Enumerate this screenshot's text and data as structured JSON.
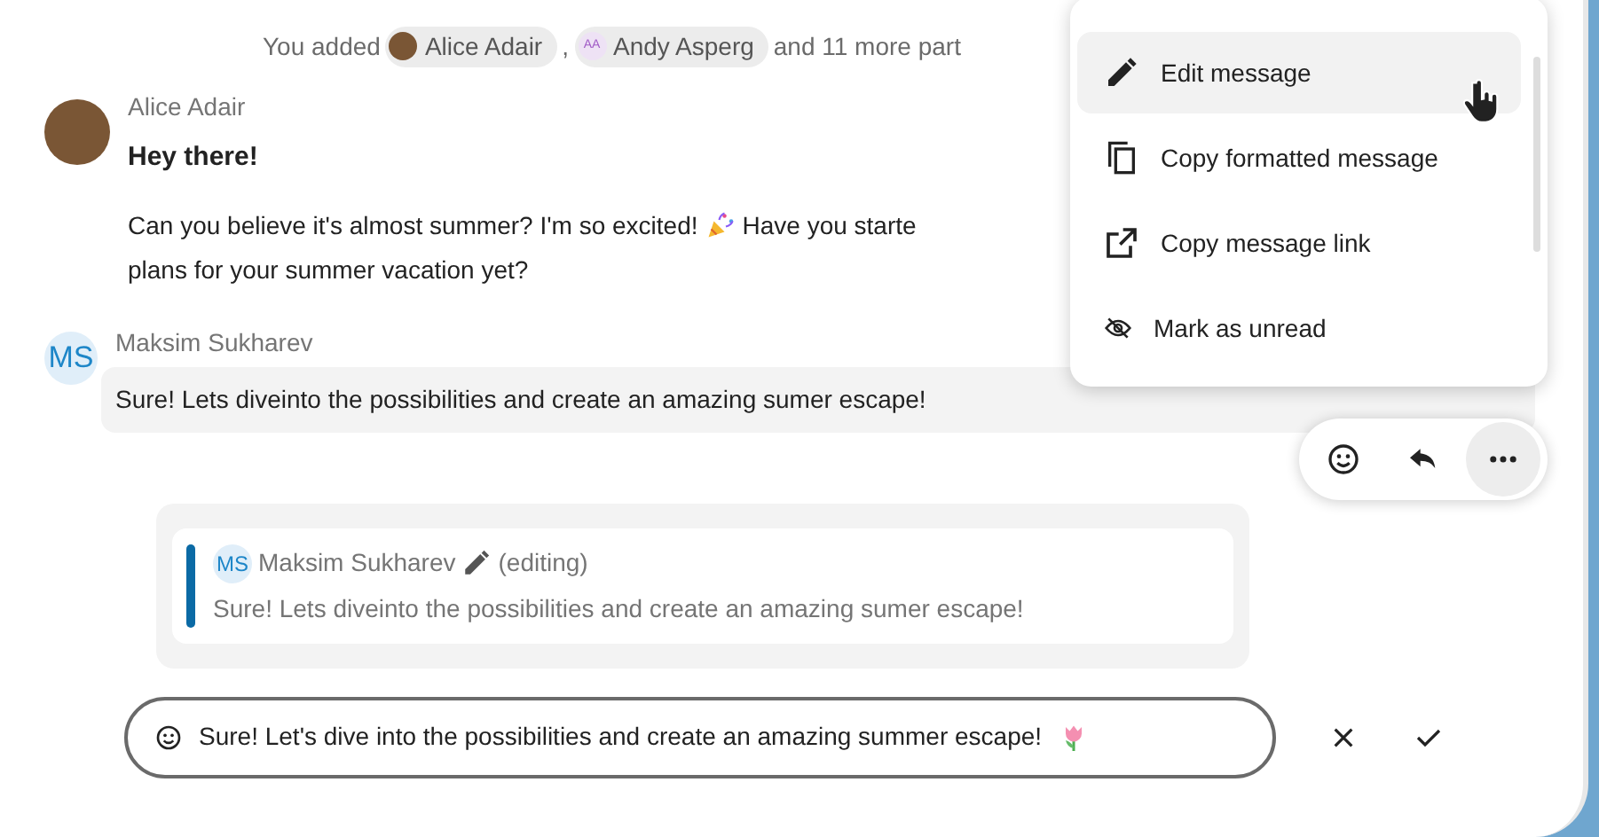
{
  "system_message": {
    "prefix": "You added",
    "participants": [
      {
        "name": "Alice Adair",
        "kind": "photo"
      },
      {
        "name": "Andy Asperg",
        "kind": "initials",
        "initials": "AA"
      }
    ],
    "separator": ",",
    "suffix": "and 11 more part"
  },
  "messages": [
    {
      "author": "Alice Adair",
      "kind": "photo",
      "title": "Hey there!",
      "lines": [
        [
          "Can you believe it's almost summer? I'm so excited!",
          "Have you starte"
        ],
        [
          "plans for your summer vacation yet?"
        ]
      ],
      "selected": false
    },
    {
      "author": "Maksim Sukharev",
      "kind": "initials",
      "initials": "MS",
      "lines": [
        [
          "Sure! Lets diveinto the possibilities and create an amazing sumer escape!"
        ]
      ],
      "selected": true
    }
  ],
  "menu": {
    "items": [
      {
        "label": "Edit message",
        "selected": true
      },
      {
        "label": "Copy formatted message",
        "selected": false
      },
      {
        "label": "Copy message link",
        "selected": false
      },
      {
        "label": "Mark as unread",
        "selected": false
      }
    ]
  },
  "actions": [
    {
      "selected": false
    },
    {
      "selected": false
    },
    {
      "selected": true
    }
  ],
  "editing": {
    "initials": "MS",
    "author": "Maksim Sukharev",
    "status": "(editing)",
    "text": "Sure! Lets diveinto the possibilities and create an amazing sumer escape!"
  },
  "composer": {
    "value": "Sure! Let's dive into the possibilities and create an amazing summer escape!"
  }
}
